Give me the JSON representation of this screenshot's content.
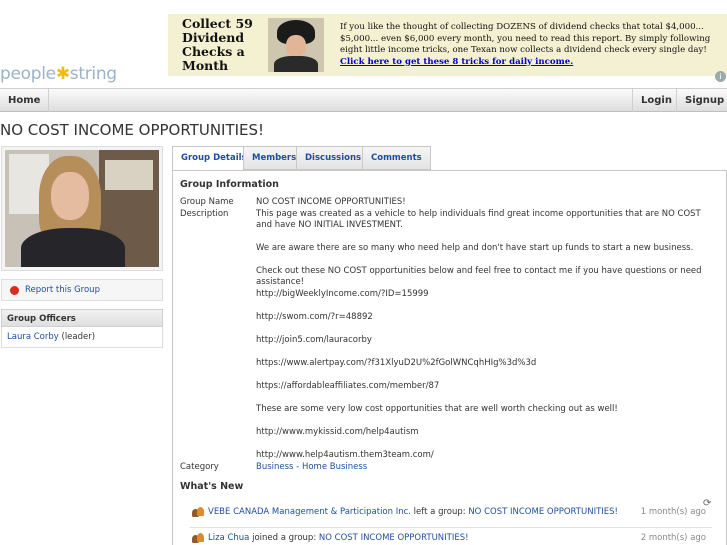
{
  "header": {
    "logo_left": "people",
    "logo_right": "string",
    "ad": {
      "headline": "Collect 59 Dividend Checks a Month",
      "body": "If you like the thought of  collecting DOZENS of dividend checks that total $4,000... $5,000... even $6,000 every month, you need to read this report. By simply following eight little income tricks, one Texan now collects a dividend check every single day!",
      "link": " Click here to get these 8 tricks for daily income."
    }
  },
  "nav": {
    "home": "Home",
    "login": "Login",
    "signup": "Signup"
  },
  "page_title": "NO COST INCOME OPPORTUNITIES!",
  "sidebar": {
    "report_link": "Report this Group",
    "officers_title": "Group Officers",
    "officer_name": "Laura Corby",
    "officer_role": " (leader)"
  },
  "tabs": [
    "Group Details",
    "Members",
    "Discussions",
    "Comments"
  ],
  "group_info": {
    "section_title": "Group Information",
    "name_label": "Group Name",
    "name_value": "NO COST INCOME OPPORTUNITIES!",
    "description_label": "Description",
    "description": [
      "This page was created as a vehicle to help individuals find great income opportunities that are NO COST and have NO INITIAL INVESTMENT.",
      "We are aware there are so many who need help and don't have start up funds to start a new business.",
      "Check out these NO COST opportunities below and feel free to contact me if you have questions or need assistance!",
      "http://bigWeeklyIncome.com/?ID=15999",
      "http://swom.com/?r=48892",
      "http://join5.com/lauracorby",
      "https://www.alertpay.com/?f31XlyuD2U%2fGolWNCqhHIg%3d%3d",
      "https://affordableaffiliates.com/member/87",
      "These are some very low cost opportunities that are well worth checking out as well!",
      "http://www.mykissid.com/help4autism",
      "http://www.help4autism.them3team.com/"
    ],
    "category_label": "Category",
    "category_value": "Business - Home Business"
  },
  "whats_new": {
    "title": "What's New",
    "items": [
      {
        "actor": "VEBE CANADA Management & Participation Inc.",
        "action": " left a group: ",
        "target": "NO COST INCOME OPPORTUNITIES!",
        "time": "1 month(s) ago"
      },
      {
        "actor": "Liza Chua",
        "action": " joined a group: ",
        "target": "NO COST INCOME OPPORTUNITIES!",
        "time": "2 month(s) ago"
      }
    ]
  },
  "colors": {
    "link": "#1f4e9a",
    "report_icon": "#d62d20",
    "logo_accent": "#f7b90f"
  }
}
